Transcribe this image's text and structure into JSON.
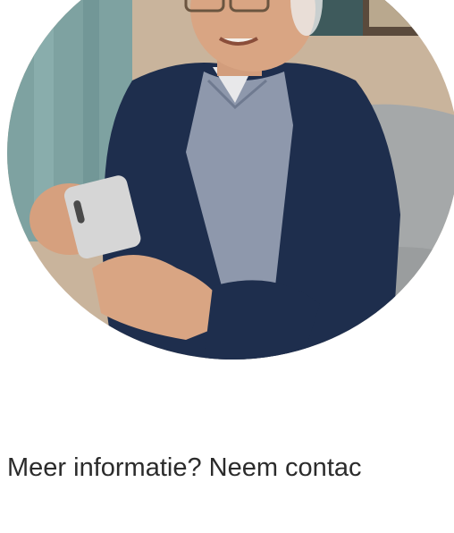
{
  "hero": {
    "image": "photo-elderly-man-smartphone",
    "image_palette": {
      "wall": "#cbb7a0",
      "curtain": "#7fa3a2",
      "cardigan": "#1f2f4e",
      "shirt": "#8f99ad",
      "sofa": "#a7aaab",
      "skin": "#d9a583",
      "phone": "#d8d8d8"
    }
  },
  "cta": {
    "text": "Meer informatie? Neem contac"
  },
  "colors": {
    "background": "#ffffff",
    "text": "#2b2b2b"
  }
}
